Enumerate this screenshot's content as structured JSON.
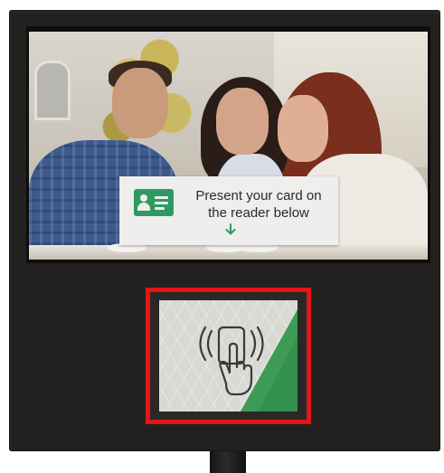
{
  "prompt": {
    "line1": "Present your card on",
    "line2": "the reader below"
  },
  "icons": {
    "card": "id-card-icon",
    "arrow": "arrow-down-icon",
    "tap": "contactless-tap-icon"
  },
  "colors": {
    "accent_green": "#2e9a63",
    "highlight_red": "#e41515",
    "kiosk_body": "#232120"
  }
}
